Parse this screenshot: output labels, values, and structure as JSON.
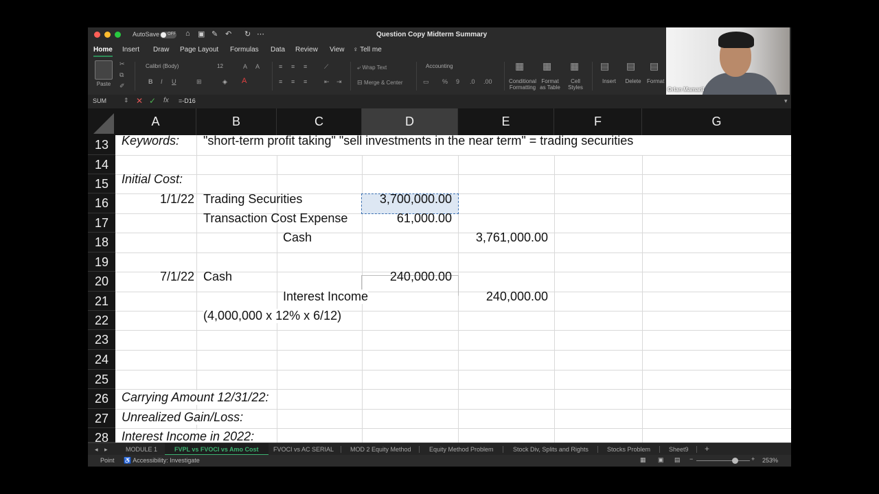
{
  "titlebar": {
    "autosave_label": "AutoSave",
    "autosave_state": "OFF",
    "document_title": "Question Copy Midterm Summary"
  },
  "ribbon_tabs": [
    "Home",
    "Insert",
    "Draw",
    "Page Layout",
    "Formulas",
    "Data",
    "Review",
    "View",
    "Tell me"
  ],
  "ribbon": {
    "paste_label": "Paste",
    "font_name": "Calibri (Body)",
    "font_size": "12",
    "wrap_text": "Wrap Text",
    "merge_center": "Merge & Center",
    "number_format": "Accounting",
    "conditional_formatting": "Conditional Formatting",
    "format_as_table": "Format as Table",
    "cell_styles": "Cell Styles",
    "insert": "Insert",
    "delete": "Delete",
    "format": "Format"
  },
  "webcam": {
    "name": "Orlan Mamaril"
  },
  "formula_bar": {
    "name_box": "SUM",
    "formula": "=-D16"
  },
  "columns": [
    "A",
    "B",
    "C",
    "D",
    "E",
    "F",
    "G"
  ],
  "rows": [
    "13",
    "14",
    "15",
    "16",
    "17",
    "18",
    "19",
    "20",
    "21",
    "22",
    "23",
    "24",
    "25",
    "26",
    "27",
    "28"
  ],
  "cells": {
    "r13_keywords": "Keywords:",
    "r13_text": "\"short-term profit taking\" \"sell investments in the near term\"  = trading securities",
    "r15_initial": "Initial Cost:",
    "r16_date": "1/1/22",
    "r16_account": "Trading Securities",
    "r16_debit": "3,700,000.00",
    "r17_account": "Transaction Cost Expense",
    "r17_debit": "61,000.00",
    "r18_account": "Cash",
    "r18_credit": "3,761,000.00",
    "r20_date": "7/1/22",
    "r20_account": "Cash",
    "r20_debit": "240,000.00",
    "r21_account": "Interest Income",
    "r21_credit": "240,000.00",
    "r22_note": "(4,000,000 x 12% x 6/12)",
    "r26_label": "Carrying Amount 12/31/22:",
    "r27_label": "Unrealized Gain/Loss:",
    "r28_label": "Interest Income in 2022:"
  },
  "sheet_tabs": [
    "MODULE 1",
    "FVPL vs FVOCI vs Amo Cost",
    "FVOCI vs AC SERIAL",
    "MOD 2 Equity Method",
    "Equity Method Problem",
    "Stock Div, Splits and Rights",
    "Stocks Problem",
    "Sheet9"
  ],
  "status": {
    "mode": "Point",
    "accessibility": "Accessibility: Investigate",
    "zoom": "253%"
  }
}
